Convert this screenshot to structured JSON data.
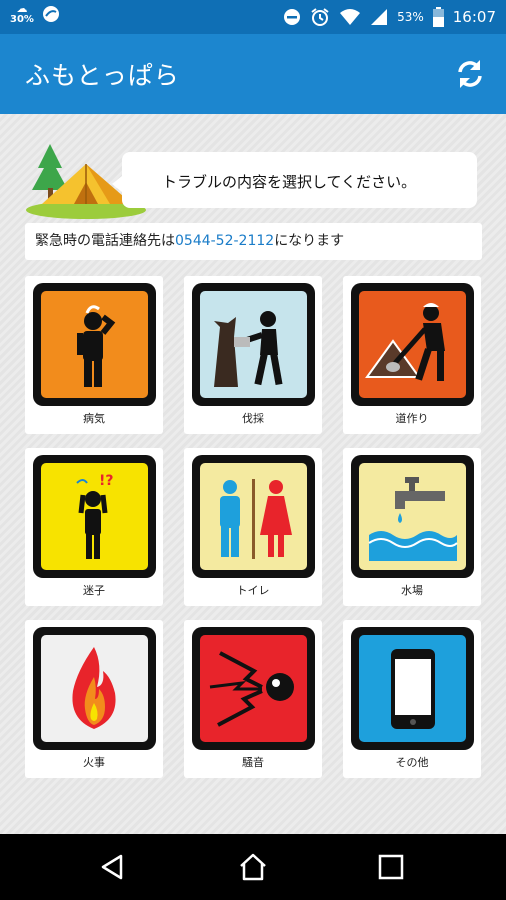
{
  "status_bar": {
    "weather_icon": "snow-cloud-icon",
    "weather_percent": "30%",
    "battery_percent": "53%",
    "time": "16:07",
    "icons": [
      "app-notification-icon",
      "do-not-disturb-icon",
      "alarm-icon",
      "wifi-icon",
      "signal-icon",
      "battery-icon"
    ]
  },
  "app_bar": {
    "title": "ふもとっぱら",
    "refresh_icon": "refresh-icon",
    "color": "#1c86cf"
  },
  "header": {
    "prompt": "トラブルの内容を選択してください。",
    "emergency_prefix": "緊急時の電話連絡先は",
    "emergency_phone": "0544-52-2112",
    "emergency_suffix": "になります"
  },
  "categories": [
    {
      "label": "病気",
      "icon": "sick-person-icon",
      "bg": "#f28c1c"
    },
    {
      "label": "伐採",
      "icon": "tree-cutting-icon",
      "bg": "#c6e4ec"
    },
    {
      "label": "道作り",
      "icon": "road-building-icon",
      "bg": "#e85a1d"
    },
    {
      "label": "迷子",
      "icon": "lost-child-icon",
      "bg": "#f7e300"
    },
    {
      "label": "トイレ",
      "icon": "toilet-icon",
      "bg": "#f4eaa0"
    },
    {
      "label": "水場",
      "icon": "water-tap-icon",
      "bg": "#f4eaa0"
    },
    {
      "label": "火事",
      "icon": "fire-icon",
      "bg": "#f0f0f0"
    },
    {
      "label": "騒音",
      "icon": "noise-icon",
      "bg": "#e8242b"
    },
    {
      "label": "その他",
      "icon": "smartphone-icon",
      "bg": "#1ea0dc"
    }
  ],
  "nav": {
    "back_icon": "back-icon",
    "home_icon": "home-icon",
    "recents_icon": "recents-icon"
  }
}
